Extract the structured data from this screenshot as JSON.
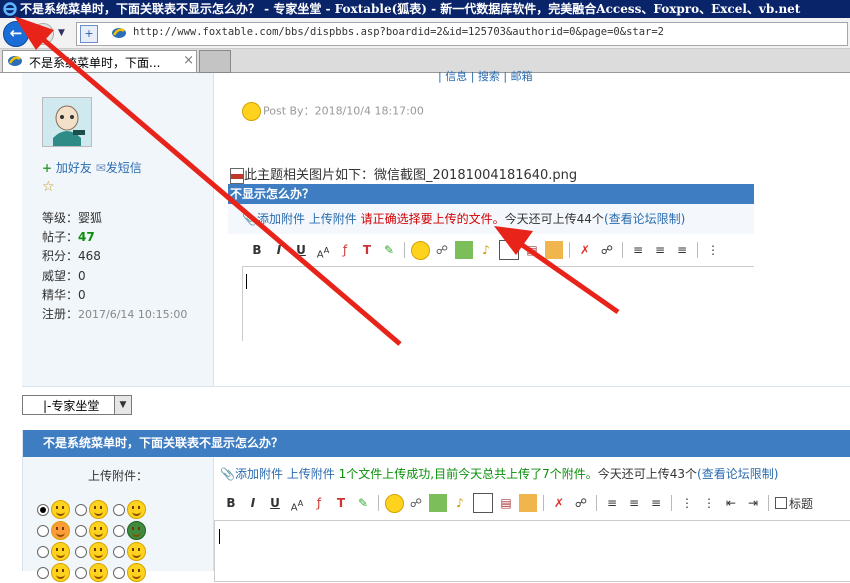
{
  "window": {
    "title": "不是系统菜单时，下面关联表不显示怎么办？ - 专家坐堂 - Foxtable(狐表) - 新一代数据库软件，完美融合Access、Foxpro、Excel、vb.net"
  },
  "address": {
    "url": "http://www.foxtable.com/bbs/dispbbs.asp?boardid=2&id=125703&authorid=0&page=0&star=2"
  },
  "tab": {
    "label": "不是系统菜单时，下面...",
    "close": "×"
  },
  "post_header_fragment": "| 信息  | 搜索  | 邮箱",
  "user": {
    "add_friend": "加好友",
    "send_msg": "发短信",
    "star": "☆",
    "stats": [
      {
        "label": "等级：",
        "value": "婴狐",
        "style": "normal"
      },
      {
        "label": "帖子：",
        "value": "47",
        "style": "green"
      },
      {
        "label": "积分：",
        "value": "468",
        "style": "normal"
      },
      {
        "label": "威望：",
        "value": "0",
        "style": "normal"
      },
      {
        "label": "精华：",
        "value": "0",
        "style": "normal"
      },
      {
        "label": "注册：",
        "value": "2017/6/14 10:15:00",
        "style": "gray"
      }
    ]
  },
  "post": {
    "posted_by": "Post By：2018/10/4 18:17:00",
    "image_line": "此主题相关图片如下：微信截图_20181004181640.png",
    "embedded_title": "不显示怎么办？",
    "embedded_attach_add": "添加附件",
    "embedded_attach_upload": "上传附件",
    "embedded_attach_warning": "请正确选择要上传的文件。",
    "embedded_attach_remaining": "今天还可上传44个",
    "embedded_attach_limit": "(查看论坛限制)"
  },
  "jump": {
    "selected": "|-专家坐堂"
  },
  "reply": {
    "title": "不是系统菜单时，下面关联表不显示怎么办？",
    "upload_label": "上传附件：",
    "attach_add": "添加附件",
    "attach_upload": "上传附件",
    "upload_success": "1个文件上传成功,目前今天总共上传了7个附件。",
    "remaining": "今天还可上传43个",
    "limit": "(查看论坛限制)",
    "heading_checkbox_label": "标题"
  },
  "colors": {
    "title_bar": "#0a246a",
    "header_blue": "#3e7dc2",
    "link_blue": "#2b6cb0",
    "warning_red": "#d40000",
    "success_green": "#0a8f0a",
    "arrow_red": "#e8241a",
    "side_panel": "#f1f6fa"
  }
}
